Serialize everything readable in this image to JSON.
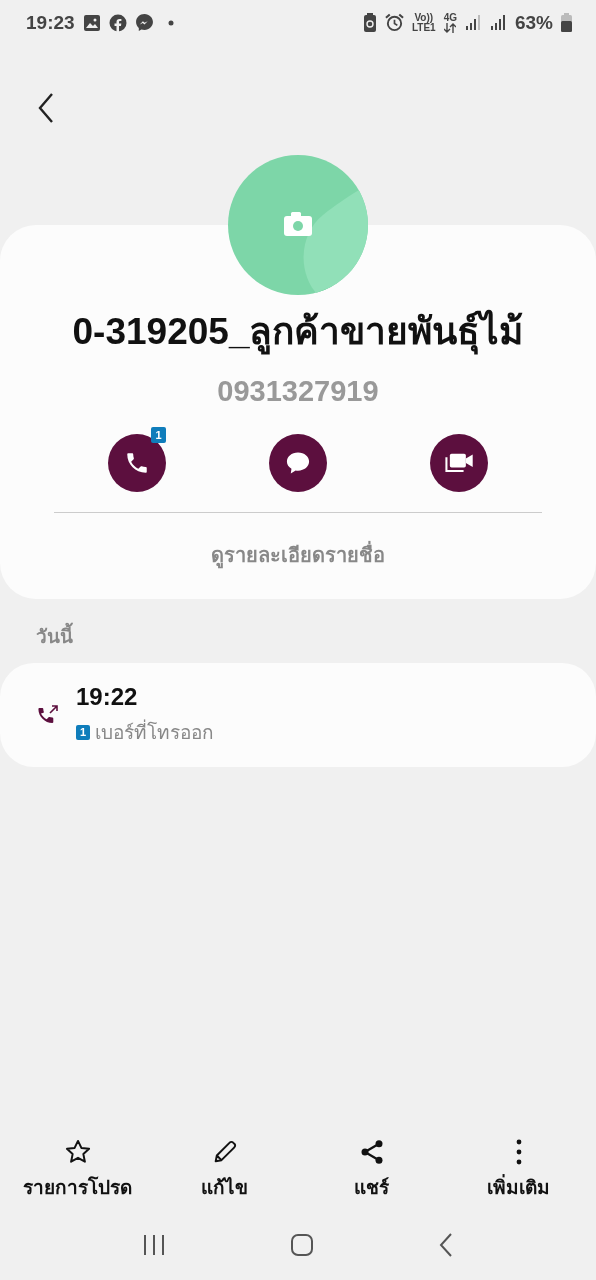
{
  "status_bar": {
    "time": "19:23",
    "volte": "Vo))",
    "lte": "LTE1",
    "network": "4G",
    "battery": "63%"
  },
  "contact": {
    "name": "0-319205_ลูกค้าขายพันธุ์ไม้",
    "number": "0931327919"
  },
  "actions": [
    {
      "kind": "call",
      "badge": "1"
    },
    {
      "kind": "message"
    },
    {
      "kind": "video"
    }
  ],
  "details_link": "ดูรายละเอียดรายชื่อ",
  "log": {
    "header": "วันนี้",
    "entries": [
      {
        "time": "19:22",
        "sim": "1",
        "type": "เบอร์ที่โทรออก"
      }
    ]
  },
  "bottom_bar": [
    {
      "kind": "favorite",
      "label": "รายการโปรด"
    },
    {
      "kind": "edit",
      "label": "แก้ไข"
    },
    {
      "kind": "share",
      "label": "แชร์"
    },
    {
      "kind": "more",
      "label": "เพิ่มเติม"
    }
  ]
}
